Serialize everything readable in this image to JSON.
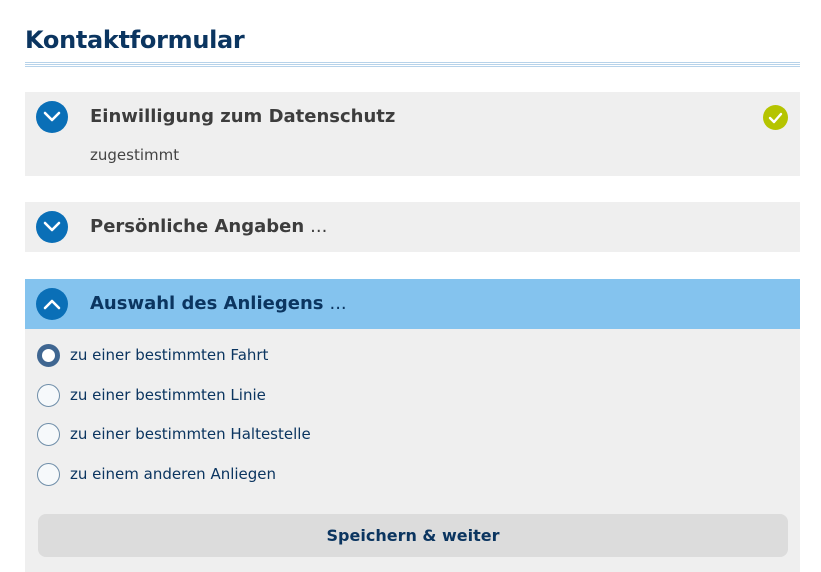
{
  "form": {
    "title": "Kontaktformular"
  },
  "sections": [
    {
      "title": "Einwilligung zum Datenschutz",
      "summary": "zugestimmt",
      "state": "collapsed",
      "completed": true
    },
    {
      "title": "Persönliche Angaben",
      "suffix": "...",
      "state": "collapsed"
    },
    {
      "title": "Auswahl des Anliegens",
      "suffix": "...",
      "state": "expanded",
      "options": [
        {
          "label": "zu einer bestimmten Fahrt",
          "selected": true
        },
        {
          "label": "zu einer bestimmten Linie",
          "selected": false
        },
        {
          "label": "zu einer bestimmten Haltestelle",
          "selected": false
        },
        {
          "label": "zu einem anderen Anliegen",
          "selected": false
        }
      ],
      "submit_label": "Speichern & weiter"
    }
  ],
  "icons": {
    "expand": "chevron-down-icon",
    "collapse": "chevron-up-icon",
    "completed": "checkmark-icon"
  },
  "colors": {
    "primary": "#0a6fb7",
    "title": "#0b3560",
    "active_header": "#84c3ee",
    "panel_background": "#efefef",
    "success": "#b5c400"
  }
}
